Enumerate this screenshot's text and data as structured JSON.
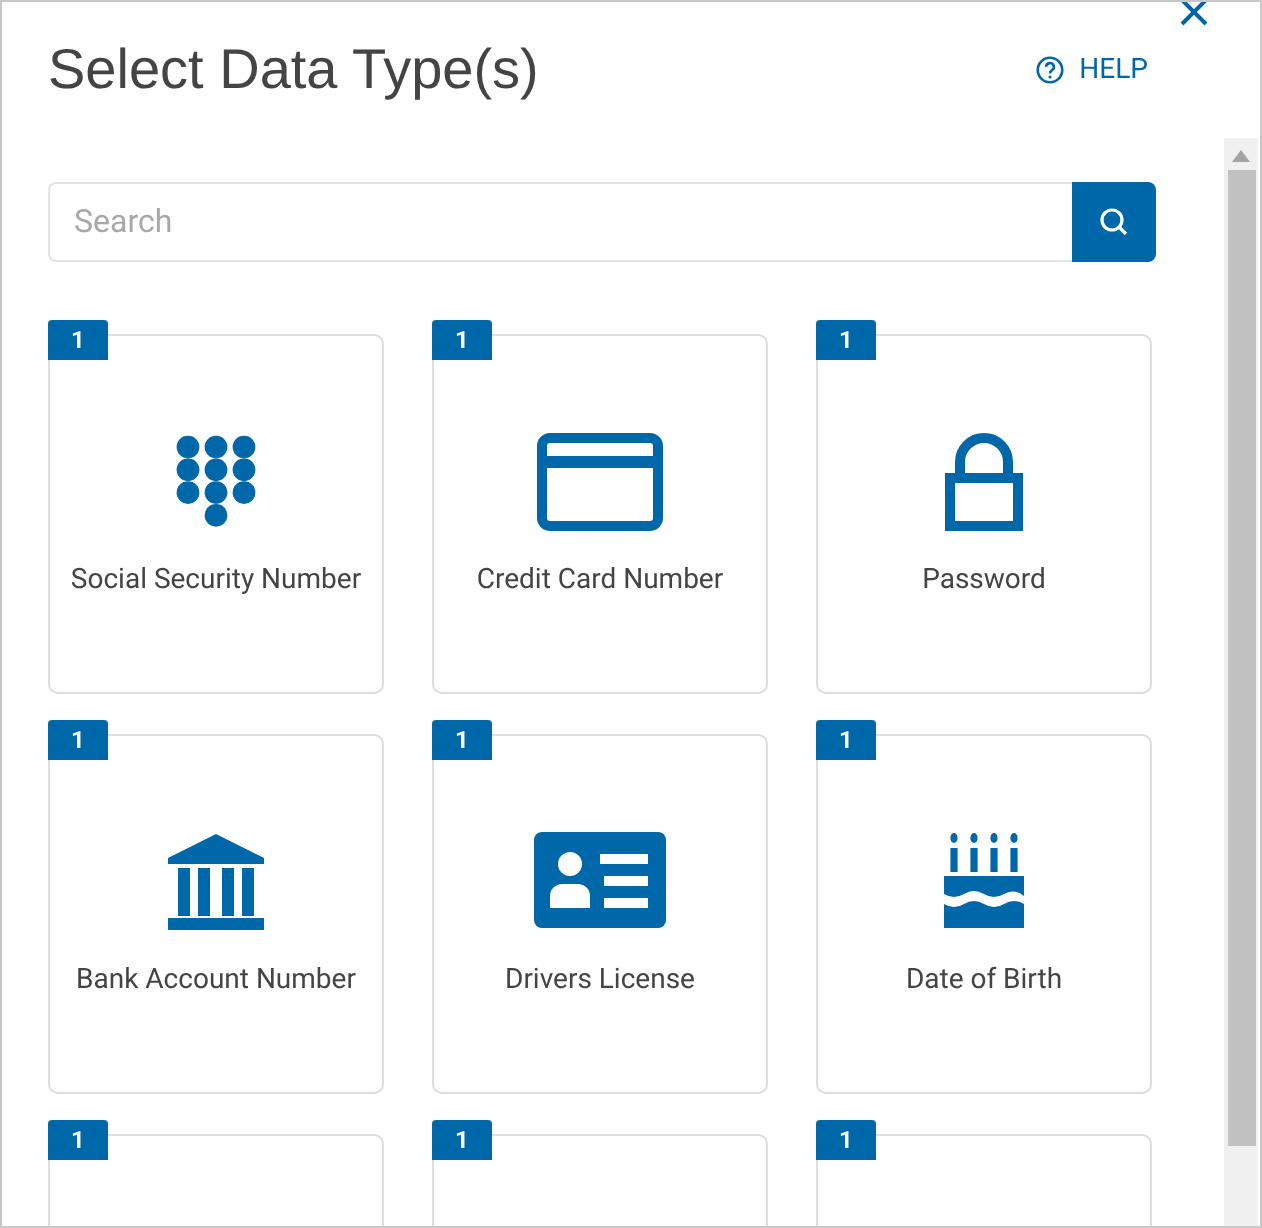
{
  "dialog": {
    "title": "Select Data Type(s)",
    "help_label": "HELP"
  },
  "search": {
    "placeholder": "Search"
  },
  "data_types": [
    {
      "label": "Social Security Number",
      "count": "1",
      "kind": "keypad"
    },
    {
      "label": "Credit Card Number",
      "count": "1",
      "kind": "card"
    },
    {
      "label": "Password",
      "count": "1",
      "kind": "lock"
    },
    {
      "label": "Bank Account Number",
      "count": "1",
      "kind": "bank"
    },
    {
      "label": "Drivers License",
      "count": "1",
      "kind": "id"
    },
    {
      "label": "Date of Birth",
      "count": "1",
      "kind": "cake"
    },
    {
      "count": "1",
      "kind": "none"
    },
    {
      "count": "1",
      "kind": "none"
    },
    {
      "count": "1",
      "kind": "none"
    }
  ]
}
